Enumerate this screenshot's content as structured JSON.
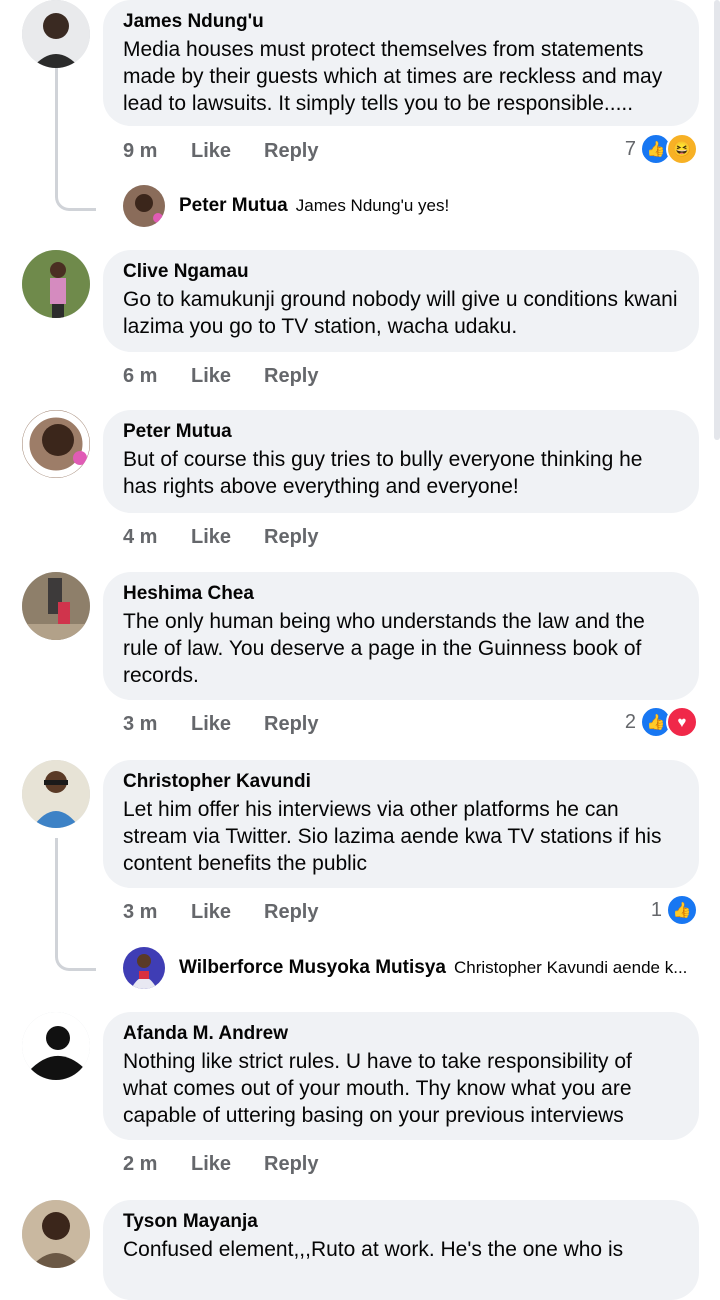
{
  "actions": {
    "like": "Like",
    "reply": "Reply"
  },
  "colors": {
    "like": "#1877f2",
    "love": "#f02849",
    "haha": "#f7b125",
    "bubble": "#f0f2f5",
    "meta": "#65676b"
  },
  "comments": [
    {
      "name": "James Ndung'u",
      "text": "Media houses must protect themselves from statements made by their guests which at times are reckless and may lead to lawsuits. It simply tells you to be responsible.....",
      "time": "9 m",
      "reactions": {
        "count": "7",
        "icons": [
          "like-icon",
          "haha-icon"
        ]
      },
      "reply": {
        "name": "Peter Mutua",
        "text": "James Ndung'u yes!"
      }
    },
    {
      "name": "Clive Ngamau",
      "text": "Go to kamukunji ground nobody will give u conditions kwani lazima you go to TV station,  wacha udaku.",
      "time": "6 m"
    },
    {
      "name": "Peter Mutua",
      "text": "But of course this guy tries to bully everyone thinking he has rights above everything and everyone!",
      "time": "4 m"
    },
    {
      "name": "Heshima Chea",
      "text": "The only human being who understands the law and the rule of law. You deserve a page in the Guinness book of records.",
      "time": "3 m",
      "reactions": {
        "count": "2",
        "icons": [
          "like-icon",
          "love-icon"
        ]
      }
    },
    {
      "name": "Christopher Kavundi",
      "text": "Let him offer his interviews via other platforms he can stream via Twitter. Sio lazima aende kwa TV stations if his content benefits the public",
      "time": "3 m",
      "reactions": {
        "count": "1",
        "icons": [
          "like-icon"
        ]
      },
      "reply": {
        "name": "Wilberforce Musyoka Mutisya",
        "text": "Christopher Kavundi aende k..."
      }
    },
    {
      "name": "Afanda M. Andrew",
      "text": "Nothing like strict rules. U have to take responsibility of what comes out of your mouth. Thy know what you are capable of  uttering basing on your previous interviews",
      "time": "2 m"
    },
    {
      "name": "Tyson Mayanja",
      "text": "Confused element,,,Ruto at work. He's the one who is"
    }
  ]
}
